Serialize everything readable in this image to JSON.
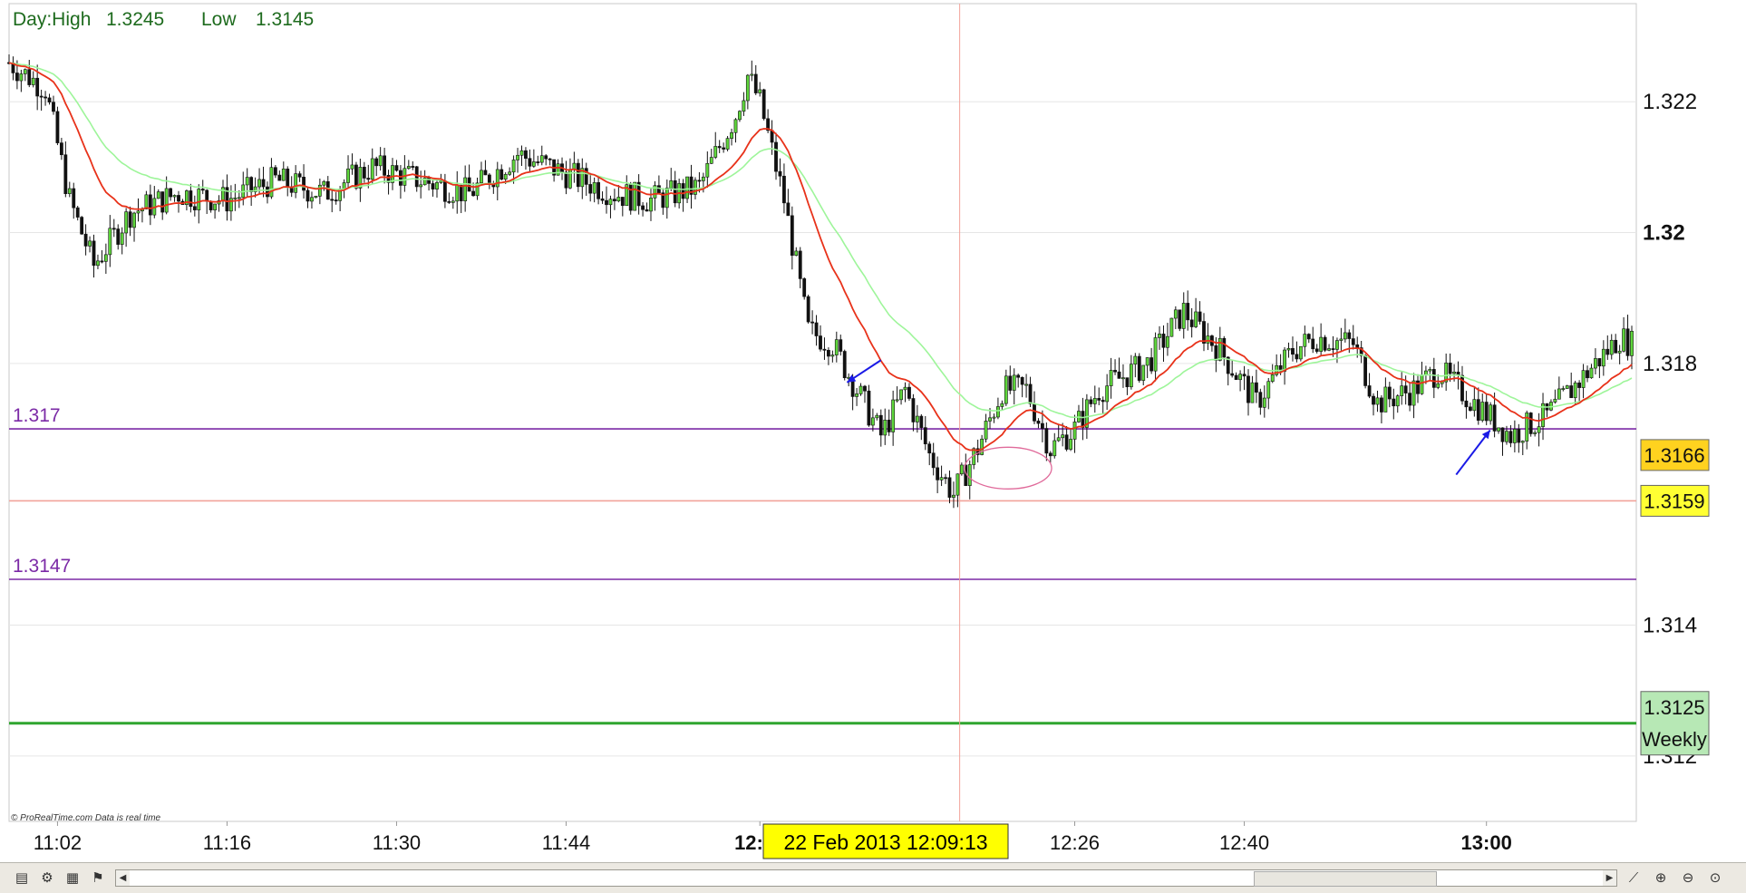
{
  "header": {
    "day_label": "Day:High",
    "high": "1.3245",
    "low_label": "Low",
    "low": "1.3145"
  },
  "credit": "© ProRealTime.com  Data  is  real  time",
  "crosshair_label": "22  Feb  2013  12:09:13",
  "toolbar": {
    "icons": [
      "chart-icon",
      "indicators-icon",
      "calculator-icon",
      "flag-icon"
    ],
    "right_icons": [
      "ruler-icon",
      "zoom-in-icon",
      "zoom-out-icon",
      "zoom-reset-icon"
    ]
  },
  "chart_data": {
    "type": "candlestick",
    "x_ticks": [
      {
        "label": "11:02",
        "t": 4
      },
      {
        "label": "11:16",
        "t": 18
      },
      {
        "label": "11:30",
        "t": 32
      },
      {
        "label": "11:44",
        "t": 46
      },
      {
        "label": "12:00",
        "t": 62,
        "bold": true
      },
      {
        "label": "12:26",
        "t": 88
      },
      {
        "label": "12:40",
        "t": 102
      },
      {
        "label": "13:00",
        "t": 122,
        "bold": true
      }
    ],
    "t_range": [
      0,
      134
    ],
    "ylim": [
      1.311,
      1.3235
    ],
    "y_ticks": [
      {
        "label": "1.322",
        "v": 1.322
      },
      {
        "label": "1.32",
        "v": 1.32,
        "bold": true
      },
      {
        "label": "1.318",
        "v": 1.318
      },
      {
        "label": "1.314",
        "v": 1.314
      },
      {
        "label": "1.312",
        "v": 1.312
      }
    ],
    "hlines": [
      {
        "label": "1.317",
        "v": 1.317,
        "color": "#7b2aa6"
      },
      {
        "label": "1.3147",
        "v": 1.3147,
        "color": "#7b2aa6"
      },
      {
        "label": "",
        "v": 1.3159,
        "color": "#f2a39a"
      }
    ],
    "weekly_line": {
      "v": 1.3125,
      "color": "#2fa52f"
    },
    "price_tags": [
      {
        "label": "1.3166",
        "v": 1.3166,
        "bg": "#ffd21f"
      },
      {
        "label": "1.3159",
        "v": 1.3159,
        "bg": "#ffff33"
      },
      {
        "label": "1.3125",
        "label2": "Weekly",
        "v": 1.3125,
        "bg": "#b7e8b5"
      }
    ],
    "crosshair_t": 78.5,
    "colors": {
      "up": "#5ed63b",
      "down": "#111111",
      "ema_fast": "#e8321a",
      "ema_slow": "#9ef59a",
      "grid": "#e6e6e6"
    },
    "path": [
      [
        0,
        1.3226
      ],
      [
        3,
        1.3222
      ],
      [
        5,
        1.3205
      ],
      [
        7,
        1.3195
      ],
      [
        10,
        1.3203
      ],
      [
        14,
        1.3206
      ],
      [
        18,
        1.3205
      ],
      [
        22,
        1.3208
      ],
      [
        26,
        1.3206
      ],
      [
        30,
        1.321
      ],
      [
        34,
        1.3208
      ],
      [
        38,
        1.3206
      ],
      [
        42,
        1.3212
      ],
      [
        46,
        1.3209
      ],
      [
        50,
        1.3206
      ],
      [
        53,
        1.3205
      ],
      [
        57,
        1.3207
      ],
      [
        60,
        1.3218
      ],
      [
        61,
        1.3224
      ],
      [
        62,
        1.322
      ],
      [
        64,
        1.3205
      ],
      [
        66,
        1.3185
      ],
      [
        68,
        1.3183
      ],
      [
        70,
        1.3176
      ],
      [
        72,
        1.3169
      ],
      [
        74,
        1.3176
      ],
      [
        76,
        1.3166
      ],
      [
        78,
        1.316
      ],
      [
        80,
        1.3167
      ],
      [
        82,
        1.3176
      ],
      [
        84,
        1.3176
      ],
      [
        86,
        1.3167
      ],
      [
        88,
        1.317
      ],
      [
        90,
        1.3176
      ],
      [
        94,
        1.318
      ],
      [
        97,
        1.3188
      ],
      [
        100,
        1.3182
      ],
      [
        103,
        1.3174
      ],
      [
        106,
        1.3182
      ],
      [
        108,
        1.3184
      ],
      [
        111,
        1.3183
      ],
      [
        113,
        1.3174
      ],
      [
        116,
        1.3176
      ],
      [
        118,
        1.3179
      ],
      [
        121,
        1.3174
      ],
      [
        124,
        1.3169
      ],
      [
        127,
        1.3172
      ],
      [
        130,
        1.3178
      ],
      [
        133,
        1.3184
      ],
      [
        134,
        1.3183
      ]
    ]
  }
}
